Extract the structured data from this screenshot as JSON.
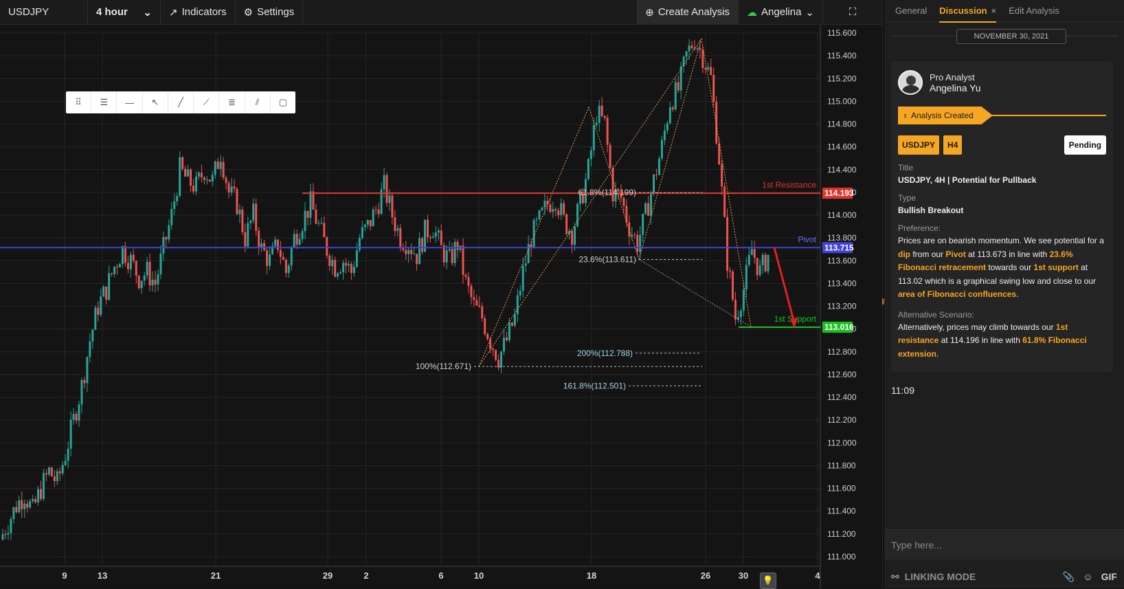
{
  "topbar": {
    "symbol": "USDJPY",
    "interval": "4 hour",
    "indicators_label": "Indicators",
    "settings_label": "Settings",
    "create_label": "Create Analysis",
    "user_label": "Angelina"
  },
  "chart_data": {
    "type": "candlestick",
    "symbol": "USDJPY",
    "interval": "4 hour",
    "price_axis": [
      "115.600",
      "115.400",
      "115.200",
      "115.000",
      "114.800",
      "114.600",
      "114.400",
      "114.200",
      "114.000",
      "113.800",
      "113.600",
      "113.400",
      "113.200",
      "113.000",
      "112.800",
      "112.600",
      "112.400",
      "112.200",
      "112.000",
      "111.800",
      "111.600",
      "111.400",
      "111.200",
      "111.000"
    ],
    "time_axis": [
      "9",
      "13",
      "21",
      "29",
      "2",
      "6",
      "10",
      "18",
      "26",
      "30",
      "4"
    ],
    "ylim": [
      111.0,
      115.6
    ],
    "grid": true,
    "levels": [
      {
        "name": "1st Resistance",
        "value": 114.193,
        "label": "114.193",
        "color": "#e0342b"
      },
      {
        "name": "Pivot",
        "value": 113.715,
        "label": "113.715",
        "color": "#3f45d9"
      },
      {
        "name": "1st Support",
        "value": 113.016,
        "label": "113.016",
        "color": "#19c21f"
      }
    ],
    "fib_labels": [
      {
        "text": "61.8%(114.199)",
        "value": 114.199
      },
      {
        "text": "23.6%(113.611)",
        "value": 113.611
      },
      {
        "text": "100%(112.671)",
        "value": 112.671
      },
      {
        "text": "200%(112.788)",
        "value": 112.788
      },
      {
        "text": "161.8%(112.501)",
        "value": 112.501
      }
    ],
    "price_path": [
      111.15,
      111.3,
      111.45,
      111.55,
      111.4,
      111.6,
      111.75,
      111.65,
      111.9,
      112.2,
      112.5,
      112.9,
      113.2,
      113.35,
      113.55,
      113.7,
      113.6,
      113.45,
      113.5,
      113.4,
      113.7,
      114.0,
      114.4,
      114.3,
      114.25,
      114.4,
      114.3,
      114.55,
      114.2,
      114.1,
      113.8,
      114.0,
      113.7,
      113.6,
      113.75,
      113.5,
      113.8,
      113.95,
      114.1,
      113.9,
      113.7,
      113.55,
      113.6,
      113.5,
      113.8,
      113.9,
      114.05,
      114.25,
      114.0,
      113.8,
      113.75,
      113.65,
      113.85,
      113.9,
      113.7,
      113.6,
      113.75,
      113.4,
      113.2,
      113.1,
      112.9,
      112.75,
      112.9,
      113.1,
      113.5,
      113.8,
      113.95,
      114.1,
      114.15,
      113.95,
      113.85,
      114.1,
      114.4,
      114.9,
      114.8,
      114.2,
      114.15,
      113.9,
      113.75,
      114.0,
      114.3,
      114.6,
      115.0,
      115.1,
      115.4,
      115.55,
      115.4,
      115.2,
      114.5,
      113.6,
      113.1,
      113.35,
      113.7,
      113.5,
      113.65
    ],
    "projection": [
      113.715,
      113.02
    ]
  },
  "drawing_tools": [
    "drag-handle-icon",
    "menu-lines-icon",
    "horizontal-line-icon",
    "cursor-arrow-icon",
    "trend-line-icon",
    "ray-line-icon",
    "parallel-channel-icon",
    "fib-retracement-icon",
    "rectangle-icon"
  ],
  "panel": {
    "tabs": {
      "general": "General",
      "discussion": "Discussion",
      "close": "×",
      "edit": "Edit Analysis"
    },
    "date": "NOVEMBER 30, 2021",
    "author_role": "Pro Analyst",
    "author_name": "Angelina Yu",
    "created_label": "Analysis Created",
    "badge_symbol": "USDJPY",
    "badge_tf": "H4",
    "status": "Pending",
    "title_label": "Title",
    "title_value": "USDJPY, 4H | Potential for Pullback",
    "type_label": "Type",
    "type_value": "Bullish Breakout",
    "pref_label": "Preference:",
    "pref_parts": [
      "Prices are on bearish momentum. We see potential for a ",
      "dip",
      " from our ",
      "Pivot",
      " at 113.673 in line with ",
      "23.6% Fibonacci retracement",
      " towards our ",
      "1st support",
      " at 113.02 which is a graphical swing low and close to our ",
      "area of Fibonacci confluences",
      "."
    ],
    "alt_label": "Alternative Scenario:",
    "alt_parts": [
      "Alternatively, prices may climb towards our ",
      "1st resistance",
      " at 114.196 in line with ",
      "61.8% Fibonacci extension",
      "."
    ],
    "time": "11:09",
    "input_placeholder": "Type here...",
    "linking_mode": "LINKING MODE",
    "gif_label": "GIF"
  },
  "colors": {
    "accent": "#f5a623",
    "bull": "#26a69a",
    "bear": "#ef5350"
  }
}
